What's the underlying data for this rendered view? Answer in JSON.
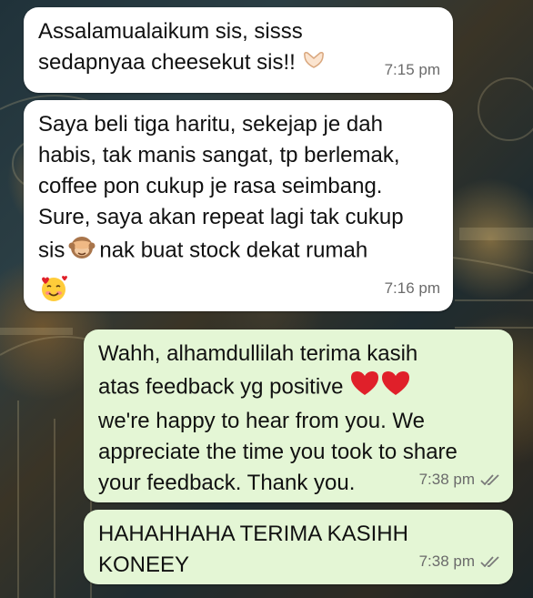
{
  "messages": [
    {
      "direction": "incoming",
      "text": "Assalamualaikum sis, sisss\nsedapnyaa cheesekut sis!!",
      "emoji_after": "heart-hands-emoji",
      "time": "7:15 pm"
    },
    {
      "direction": "incoming",
      "text": "Saya beli tiga haritu, sekejap je dah\nhabis, tak manis sangat, tp berlemak,\ncoffee pon cukup je rasa seimbang.\nSure, saya akan repeat lagi tak cukup\nsis",
      "text_tail": "nak buat stock dekat rumah",
      "emojis": [
        "see-no-evil-monkey-emoji",
        "smiling-face-with-hearts-emoji"
      ],
      "time": "7:16 pm"
    },
    {
      "direction": "outgoing",
      "text_line1": "Wahh, alhamdullilah terima kasih",
      "text_line2": "atas feedback yg positive",
      "text_rest": "we're happy to hear from you. We\nappreciate the time you took to share\nyour feedback. Thank you.",
      "emojis": [
        "red-heart-emoji",
        "red-heart-emoji"
      ],
      "time": "7:38 pm",
      "status": "read-double-check-icon"
    },
    {
      "direction": "outgoing",
      "text": "HAHAHHAHA TERIMA KASIHH\nKONEEY",
      "time": "7:38 pm",
      "status": "read-double-check-icon"
    }
  ],
  "colors": {
    "incoming_bubble": "#ffffff",
    "outgoing_bubble": "#e4f6d5",
    "timestamp": "#6b6b6b",
    "heart": "#e0202a"
  }
}
